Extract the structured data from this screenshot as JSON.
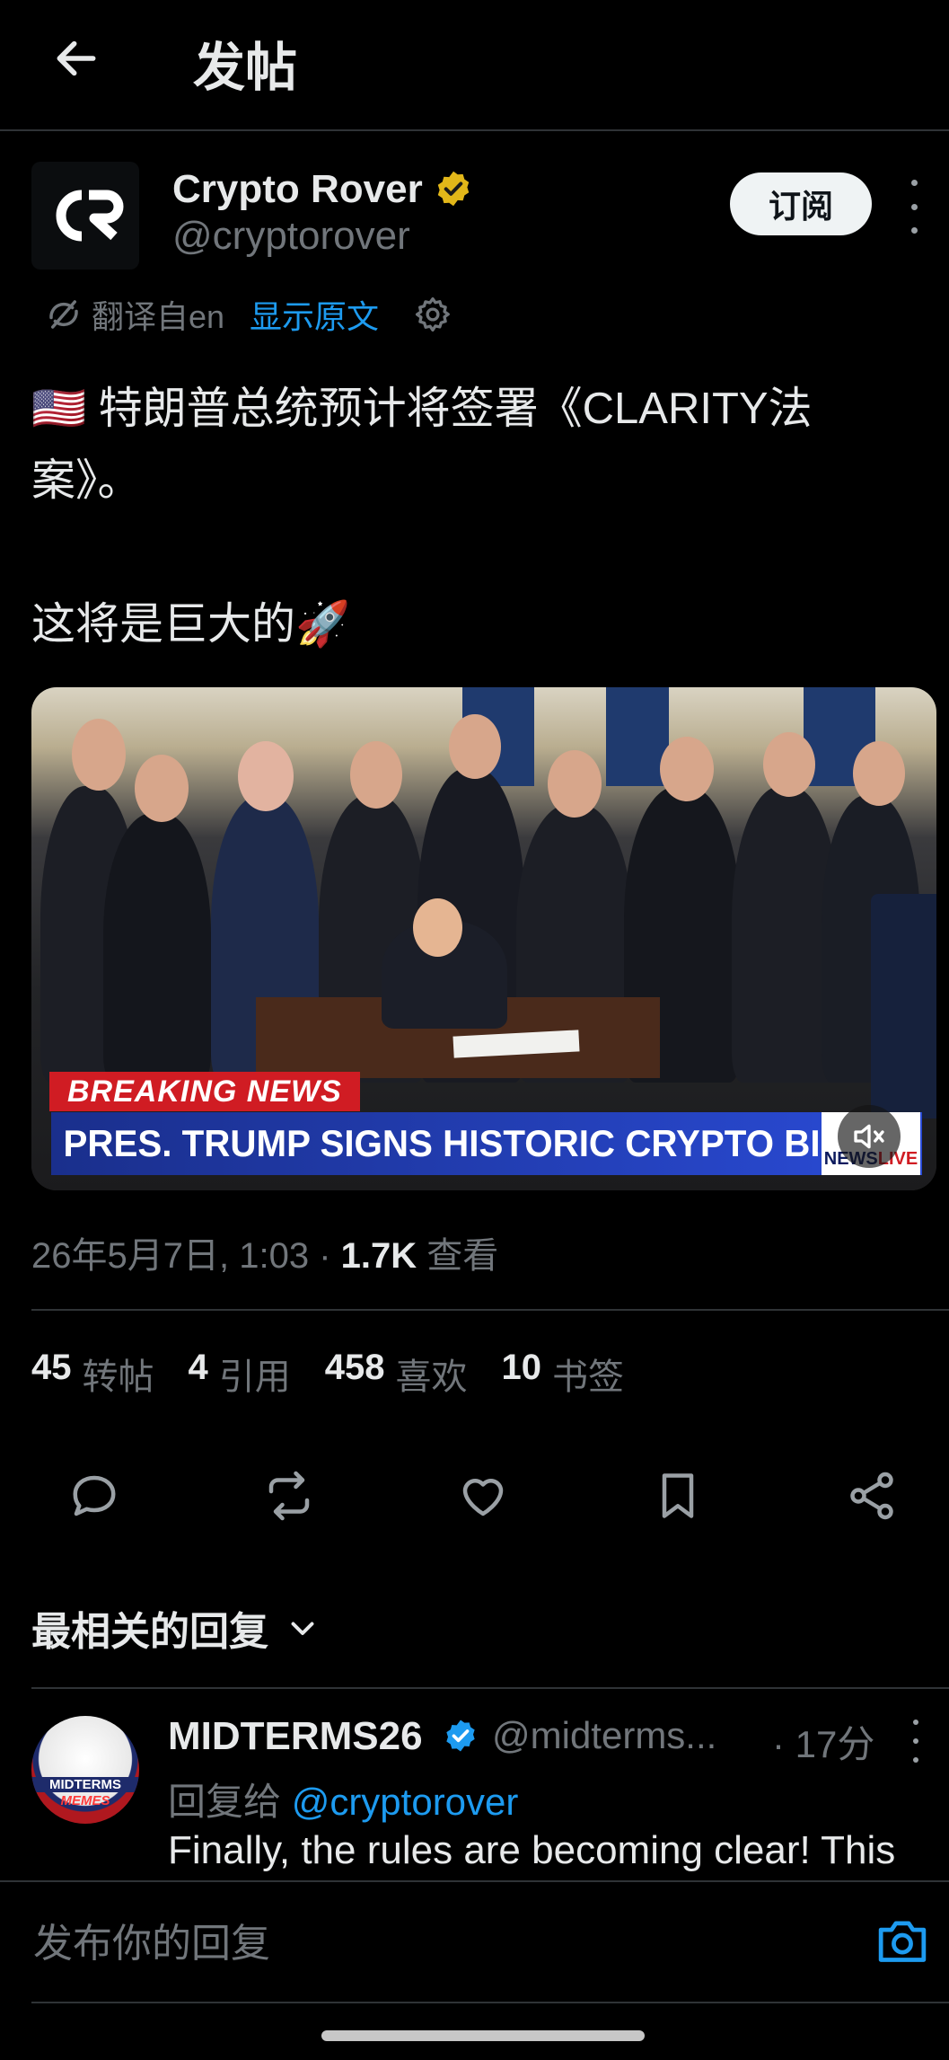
{
  "header": {
    "title": "发帖",
    "back_icon": "arrow-left-icon"
  },
  "author": {
    "logo_text": "CR",
    "name": "Crypto Rover",
    "handle": "@cryptorover",
    "verified_color": "#e2b719",
    "subscribe_label": "订阅"
  },
  "translation": {
    "label": "翻译自en",
    "show_original": "显示原文"
  },
  "post": {
    "text": "🇺🇸 特朗普总统预计将签署《CLARITY法案》。\n\n这将是巨大的🚀",
    "media": {
      "breaking_label": "BREAKING NEWS",
      "headline": "PRES. TRUMP SIGNS HISTORIC CRYPTO BILL",
      "channel_news": "NEWS",
      "channel_live": "LIVE"
    },
    "timestamp": "26年5月7日, 1:03",
    "views_count": "1.7K",
    "views_label": "查看"
  },
  "stats": [
    {
      "num": "45",
      "label": "转帖"
    },
    {
      "num": "4",
      "label": "引用"
    },
    {
      "num": "458",
      "label": "喜欢"
    },
    {
      "num": "10",
      "label": "书签"
    }
  ],
  "actions": [
    "reply-icon",
    "repost-icon",
    "like-icon",
    "bookmark-icon",
    "share-icon"
  ],
  "replies_filter": "最相关的回复",
  "reply": {
    "avatar_top": "MIDTERMS",
    "avatar_bottom": "MEMES",
    "name": "MIDTERMS26",
    "handle": "@midterms...",
    "time": "· 17分",
    "reply_to_label": "回复给",
    "reply_to_handle": "@cryptorover",
    "text": "Finally, the rules are becoming clear! This"
  },
  "composer": {
    "placeholder": "发布你的回复"
  },
  "colors": {
    "accent": "#1d9bf0",
    "background": "#000000",
    "muted": "#71767b",
    "breaking_red": "#d01c23",
    "headline_blue": "#2a4bd6"
  }
}
